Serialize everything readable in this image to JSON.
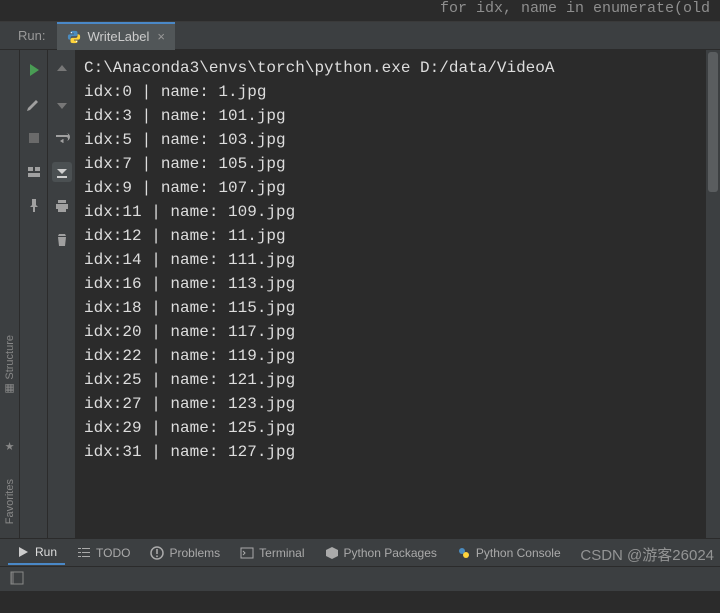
{
  "editor_hint": "for idx, name in enumerate(old",
  "run": {
    "label": "Run:"
  },
  "tab": {
    "name": "WriteLabel",
    "close": "×"
  },
  "console": {
    "cmd": "C:\\Anaconda3\\envs\\torch\\python.exe D:/data/VideoA",
    "rows": [
      {
        "idx": 0,
        "name": "1.jpg"
      },
      {
        "idx": 3,
        "name": "101.jpg"
      },
      {
        "idx": 5,
        "name": "103.jpg"
      },
      {
        "idx": 7,
        "name": "105.jpg"
      },
      {
        "idx": 9,
        "name": "107.jpg"
      },
      {
        "idx": 11,
        "name": "109.jpg"
      },
      {
        "idx": 12,
        "name": "11.jpg"
      },
      {
        "idx": 14,
        "name": "111.jpg"
      },
      {
        "idx": 16,
        "name": "113.jpg"
      },
      {
        "idx": 18,
        "name": "115.jpg"
      },
      {
        "idx": 20,
        "name": "117.jpg"
      },
      {
        "idx": 22,
        "name": "119.jpg"
      },
      {
        "idx": 25,
        "name": "121.jpg"
      },
      {
        "idx": 27,
        "name": "123.jpg"
      },
      {
        "idx": 29,
        "name": "125.jpg"
      },
      {
        "idx": 31,
        "name": "127.jpg"
      }
    ]
  },
  "side_tabs": {
    "structure": "Structure",
    "favorites": "Favorites"
  },
  "bottom": {
    "run": "Run",
    "todo": "TODO",
    "problems": "Problems",
    "terminal": "Terminal",
    "packages": "Python Packages",
    "console": "Python Console"
  },
  "watermark": "CSDN @游客26024"
}
